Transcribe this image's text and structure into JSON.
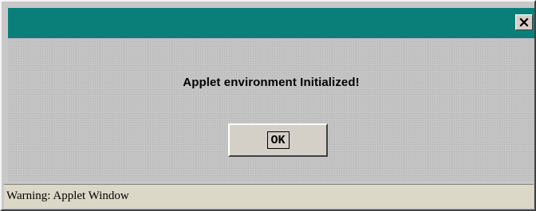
{
  "dialog": {
    "title": "",
    "message": "Applet environment Initialized!",
    "ok_label": "OK",
    "close_glyph": "×",
    "status": "Warning: Applet Window"
  },
  "colors": {
    "titlebar": "#0a7f79",
    "background": "#c4c4c4",
    "status_bar": "#dcd8c8"
  },
  "icons": {
    "close": "close-icon"
  }
}
